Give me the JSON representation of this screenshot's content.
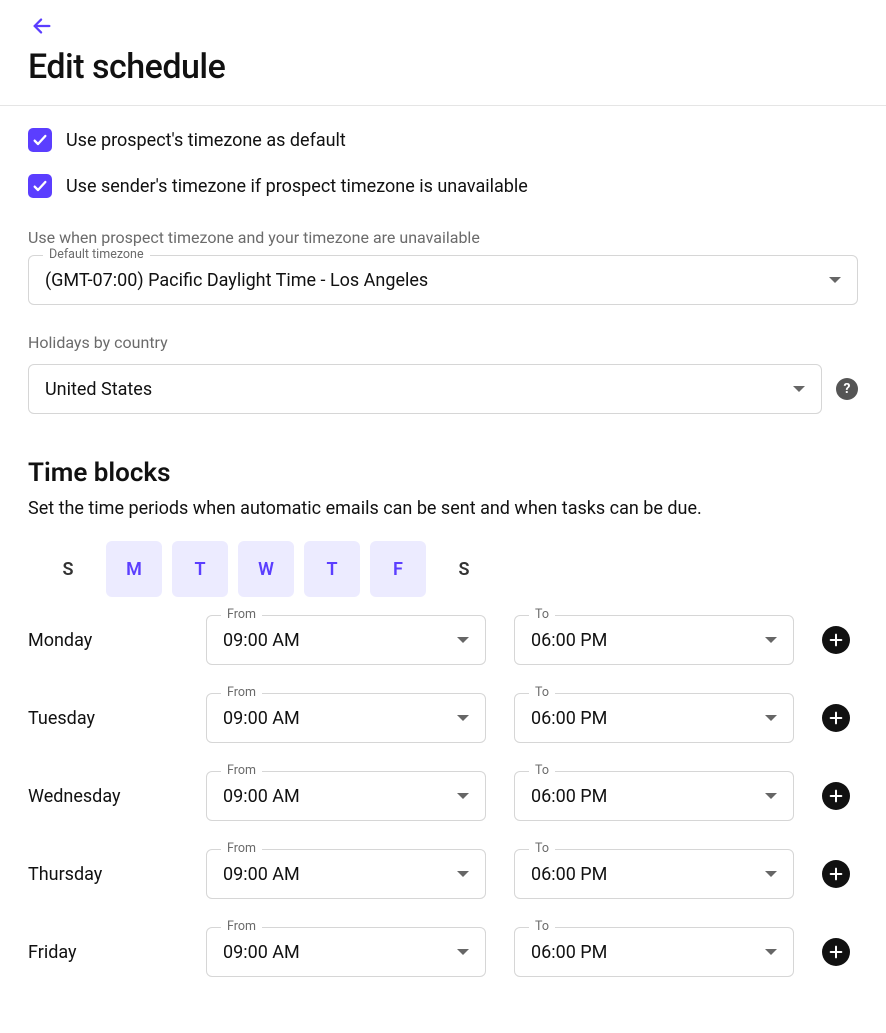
{
  "header": {
    "title": "Edit schedule"
  },
  "checkboxes": {
    "use_prospect_tz": "Use prospect's timezone as default",
    "use_sender_tz": "Use sender's timezone if prospect timezone is unavailable"
  },
  "default_tz_section": {
    "helper": "Use when prospect timezone and your timezone are unavailable",
    "label": "Default timezone",
    "value": "(GMT-07:00) Pacific Daylight Time - Los Angeles"
  },
  "holidays": {
    "label": "Holidays by country",
    "value": "United States"
  },
  "time_blocks": {
    "title": "Time blocks",
    "desc": "Set the time periods when automatic emails can be sent and when tasks can be due.",
    "days_strip": [
      {
        "letter": "S",
        "active": false
      },
      {
        "letter": "M",
        "active": true
      },
      {
        "letter": "T",
        "active": true
      },
      {
        "letter": "W",
        "active": true
      },
      {
        "letter": "T",
        "active": true
      },
      {
        "letter": "F",
        "active": true
      },
      {
        "letter": "S",
        "active": false
      }
    ],
    "from_label": "From",
    "to_label": "To",
    "rows": [
      {
        "day": "Monday",
        "from": "09:00 AM",
        "to": "06:00 PM"
      },
      {
        "day": "Tuesday",
        "from": "09:00 AM",
        "to": "06:00 PM"
      },
      {
        "day": "Wednesday",
        "from": "09:00 AM",
        "to": "06:00 PM"
      },
      {
        "day": "Thursday",
        "from": "09:00 AM",
        "to": "06:00 PM"
      },
      {
        "day": "Friday",
        "from": "09:00 AM",
        "to": "06:00 PM"
      }
    ]
  }
}
